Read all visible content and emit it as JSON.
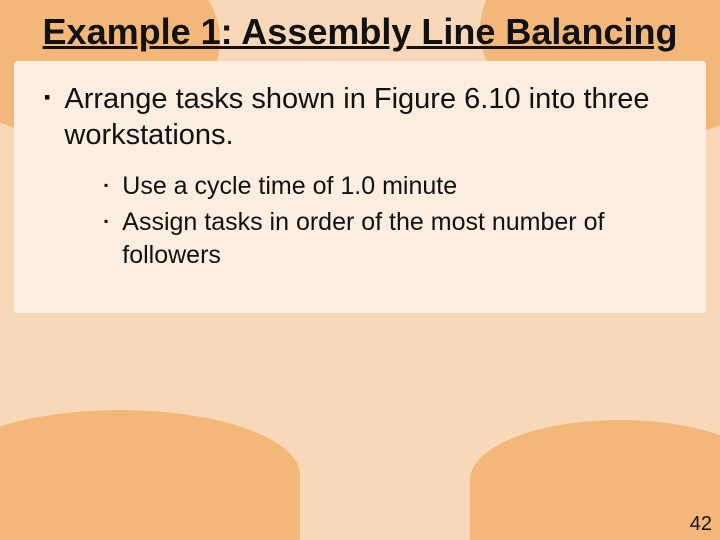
{
  "title": "Example 1: Assembly Line Balancing",
  "bullets": [
    {
      "text": "Arrange tasks shown in Figure 6.10 into three workstations.",
      "sub": [
        {
          "text": "Use a cycle time of 1.0 minute"
        },
        {
          "text": "Assign tasks in order of the most number of followers"
        }
      ]
    }
  ],
  "page_number": "42"
}
